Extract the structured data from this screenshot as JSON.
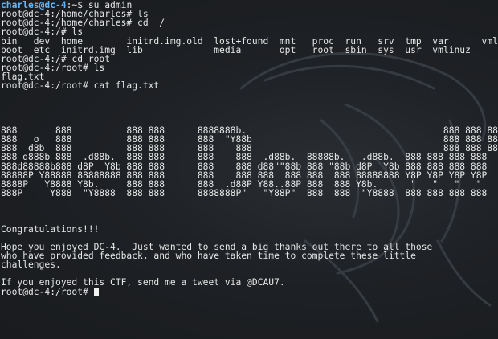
{
  "terminal": {
    "lines": [
      {
        "kind": "user-prompt",
        "user": "charles@dc-4",
        "path": ":~$ ",
        "cmd": "su admin"
      },
      {
        "kind": "text",
        "text": "root@dc-4:/home/charles# ls"
      },
      {
        "kind": "text",
        "text": "root@dc-4:/home/charles# cd  /"
      },
      {
        "kind": "text",
        "text": "root@dc-4:/# ls"
      },
      {
        "kind": "text",
        "text": "bin   dev  home        initrd.img.old  lost+found  mnt   proc  run   srv  tmp  var      vml"
      },
      {
        "kind": "text",
        "text": "boot  etc  initrd.img  lib             media       opt   root  sbin  sys  usr  vmlinuz"
      },
      {
        "kind": "text",
        "text": "root@dc-4:/# cd root"
      },
      {
        "kind": "text",
        "text": "root@dc-4:/root# ls"
      },
      {
        "kind": "text",
        "text": "flag.txt"
      },
      {
        "kind": "text",
        "text": "root@dc-4:/root# cat flag.txt"
      },
      {
        "kind": "text",
        "text": ""
      },
      {
        "kind": "text",
        "text": ""
      },
      {
        "kind": "text",
        "text": ""
      },
      {
        "kind": "text",
        "text": ""
      },
      {
        "kind": "text",
        "text": "888       888          888 888      8888888b.                                    888 888 888 888"
      },
      {
        "kind": "text",
        "text": "888   o   888          888 888      888  \"Y88b                                   888 888 888 888"
      },
      {
        "kind": "text",
        "text": "888  d8b  888          888 888      888    888                                   888 888 888 888"
      },
      {
        "kind": "text",
        "text": "888 d888b 888  .d88b.  888 888      888    888  .d88b.  88888b.   .d88b.  888 888 888 888"
      },
      {
        "kind": "text",
        "text": "888d88888b888 d8P  Y8b 888 888      888    888 d88\"\"88b 888 \"88b d8P  Y8b 888 888 888 888"
      },
      {
        "kind": "text",
        "text": "88888P Y88888 88888888 888 888      888    888 888  888 888  888 88888888 Y8P Y8P Y8P Y8P"
      },
      {
        "kind": "text",
        "text": "8888P   Y8888 Y8b.     888 888      888  .d88P Y88..88P 888  888 Y8b.      \"   \"   \"   \""
      },
      {
        "kind": "text",
        "text": "888P     Y888  \"Y8888  888 888      8888888P\"   \"Y88P\"  888  888  \"Y8888  888 888 888 888"
      },
      {
        "kind": "text",
        "text": ""
      },
      {
        "kind": "text",
        "text": ""
      },
      {
        "kind": "text",
        "text": ""
      },
      {
        "kind": "text",
        "text": "Congratulations!!!"
      },
      {
        "kind": "text",
        "text": ""
      },
      {
        "kind": "text",
        "text": "Hope you enjoyed DC-4.  Just wanted to send a big thanks out there to all those"
      },
      {
        "kind": "text",
        "text": "who have provided feedback, and who have taken time to complete these little"
      },
      {
        "kind": "text",
        "text": "challenges."
      },
      {
        "kind": "text",
        "text": ""
      },
      {
        "kind": "text",
        "text": "If you enjoyed this CTF, send me a tweet via @DCAU7."
      },
      {
        "kind": "cursor-prompt",
        "text": "root@dc-4:/root# "
      }
    ]
  },
  "colors": {
    "background": "#1c1f23",
    "text": "#e6e6e6",
    "prompt_user": "#5fb6ff",
    "cursor": "#f0f0f0"
  },
  "icons": {
    "background_watermark": "kali-dragon-icon",
    "cursor": "block-cursor"
  }
}
